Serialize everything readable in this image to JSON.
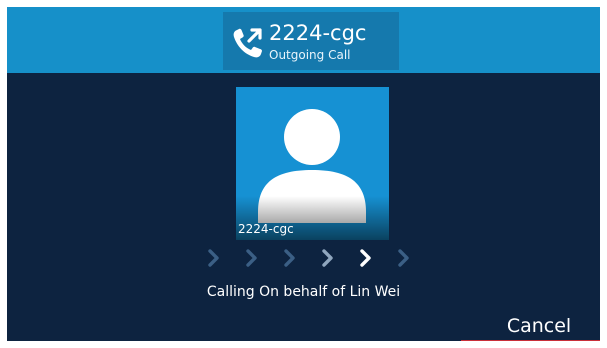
{
  "header": {
    "callee": "2224-cgc",
    "status": "Outgoing Call",
    "icon": "outgoing-call-icon"
  },
  "contact_card": {
    "name": "2224-cgc",
    "avatar_icon": "default-person-avatar-icon"
  },
  "progress": {
    "step_count": 6,
    "active_step": 5,
    "colors": {
      "dim": "#3b5f85",
      "mid": "#8fa6be",
      "bright": "#ffffff"
    }
  },
  "status_text": "Calling On behalf of Lin Wei",
  "softkeys": {
    "cancel_label": "Cancel"
  },
  "colors": {
    "background": "#0d2340",
    "top_bar": "#1690c9",
    "header_box": "#1579ad",
    "card": "#1691d3",
    "softkey_accent": "#c9303a"
  }
}
